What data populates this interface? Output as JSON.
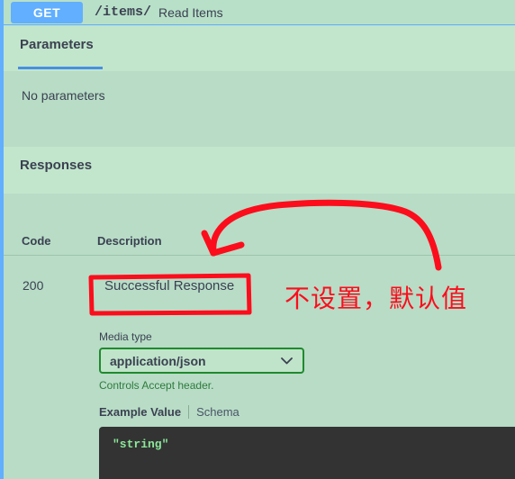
{
  "operation": {
    "method": "GET",
    "path": "/items/",
    "summary": "Read Items"
  },
  "parameters": {
    "tab_label": "Parameters",
    "empty_text": "No parameters"
  },
  "responses": {
    "section_label": "Responses",
    "columns": {
      "code": "Code",
      "description": "Description"
    },
    "rows": [
      {
        "code": "200",
        "description": "Successful Response"
      }
    ],
    "media_type": {
      "label": "Media type",
      "selected": "application/json",
      "options": [
        "application/json"
      ],
      "hint": "Controls Accept header.",
      "chevron_icon": "chevron-down-icon"
    },
    "example": {
      "tab_example_value": "Example Value",
      "tab_schema": "Schema",
      "code": "\"string\""
    }
  },
  "annotations": {
    "note_text": "不设置，默认值",
    "highlight_target": "Successful Response",
    "arrow_icon": "curved-arrow-icon",
    "color": "#fc0d1c"
  },
  "colors": {
    "method_badge": "#61affe",
    "tab_underline": "#4990e2",
    "select_border": "#1f8a2e",
    "hint_text": "#2f7b3d",
    "code_background": "#333333",
    "code_text": "#8ce89a",
    "annotation_red": "#fc0d1c",
    "section_background": "#c2e6cc",
    "body_background": "#b8dcc6"
  }
}
